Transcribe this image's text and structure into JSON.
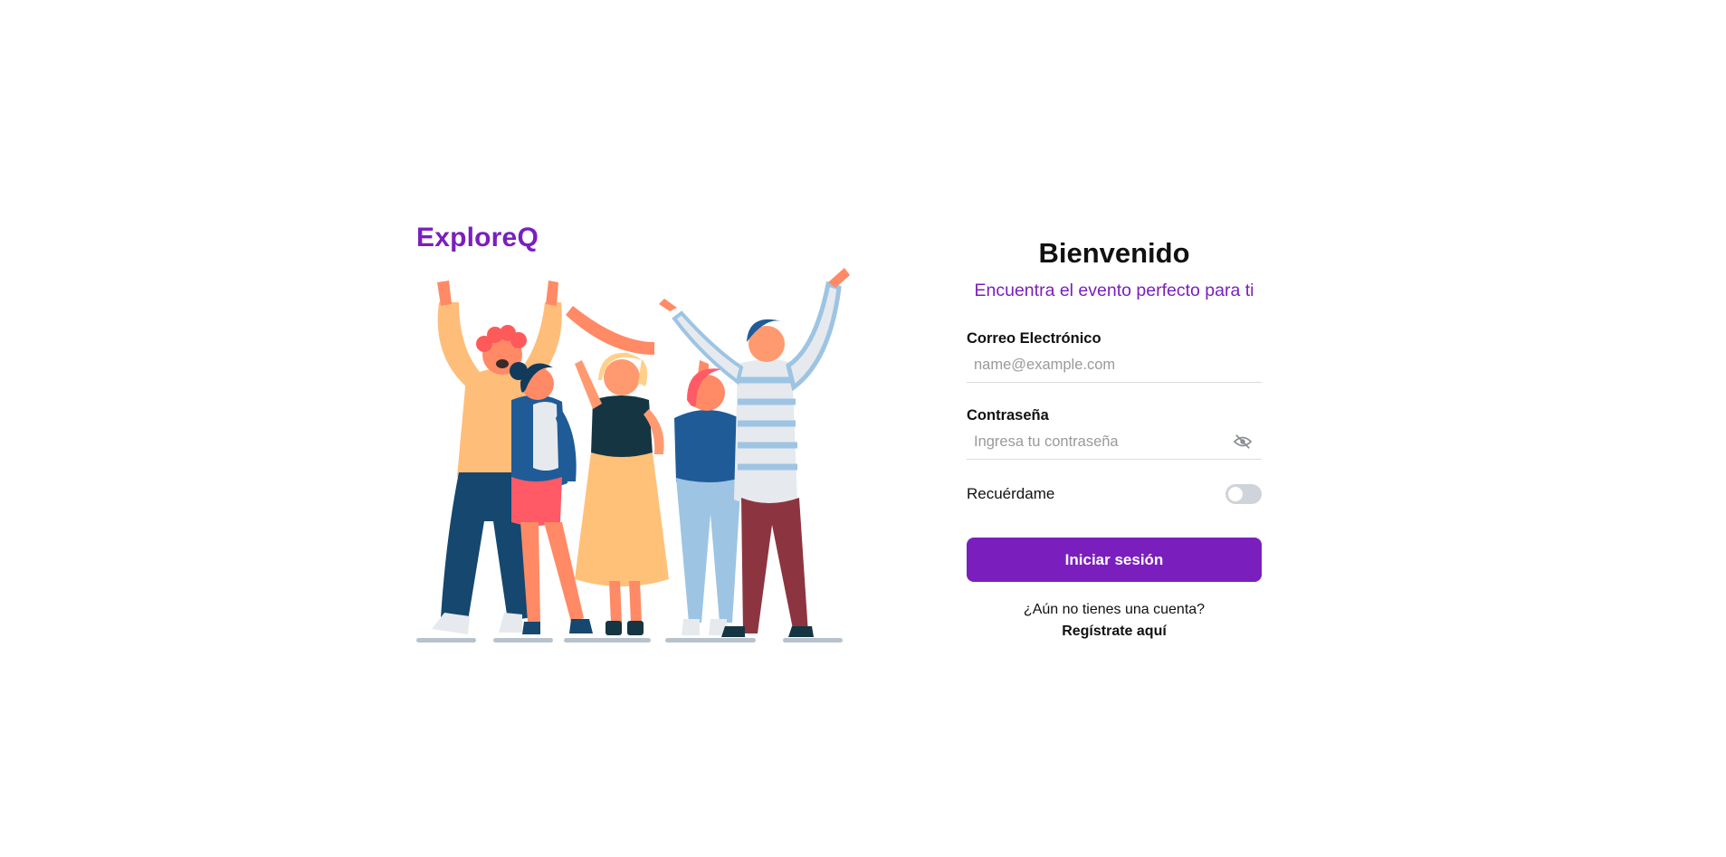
{
  "brand": {
    "name": "ExploreQ",
    "color": "#7a1fbd"
  },
  "illustration": {
    "icon": "group-of-friends-cheering-illustration"
  },
  "login": {
    "title": "Bienvenido",
    "subtitle": "Encuentra el evento perfecto para ti",
    "email": {
      "label": "Correo Electrónico",
      "placeholder": "name@example.com",
      "value": ""
    },
    "password": {
      "label": "Contraseña",
      "placeholder": "Ingresa tu contraseña",
      "value": "",
      "toggle_icon": "eye-slash-icon"
    },
    "remember": {
      "label": "Recuérdame",
      "enabled": false
    },
    "submit_label": "Iniciar sesión",
    "no_account_text": "¿Aún no tienes una cuenta?",
    "register_link": "Regístrate aquí"
  },
  "colors": {
    "accent": "#7a1fbd",
    "toggle_off": "#cfd3da",
    "text": "#111111",
    "placeholder": "#9a9a9a"
  }
}
